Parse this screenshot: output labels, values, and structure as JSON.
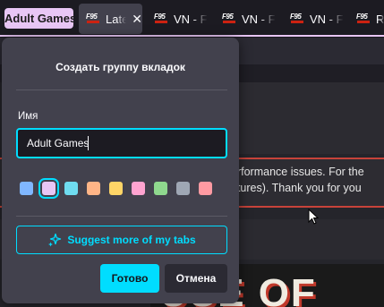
{
  "tabs": {
    "group_label": "Adult Games",
    "group_color": "#e8c6f5",
    "active_tab": {
      "title": "Late",
      "close": "✕"
    },
    "other_tabs": [
      {
        "favicon": "F95",
        "title": "VN - F"
      },
      {
        "favicon": "F95",
        "title": "VN - F"
      },
      {
        "favicon": "F95",
        "title": "VN - F"
      },
      {
        "favicon": "F95",
        "title": "R"
      }
    ]
  },
  "background_page": {
    "notice_line1": "erformance issues. For the",
    "notice_line2": "atures). Thank you for you",
    "banner_text": "USE OF"
  },
  "dialog": {
    "title": "Создать группу вкладок",
    "name_label": "Имя",
    "name_value": "Adult Games",
    "colors": [
      "#80b7ff",
      "#e8c6f5",
      "#6fdcf0",
      "#ffb587",
      "#ffd567",
      "#ffa3d0",
      "#8fd88e",
      "#9fa7b4",
      "#ff9aa2"
    ],
    "selected_color_index": 1,
    "suggest_label": "Suggest more of my tabs",
    "ok_label": "Готово",
    "cancel_label": "Отмена",
    "accent": "#00ddff"
  }
}
